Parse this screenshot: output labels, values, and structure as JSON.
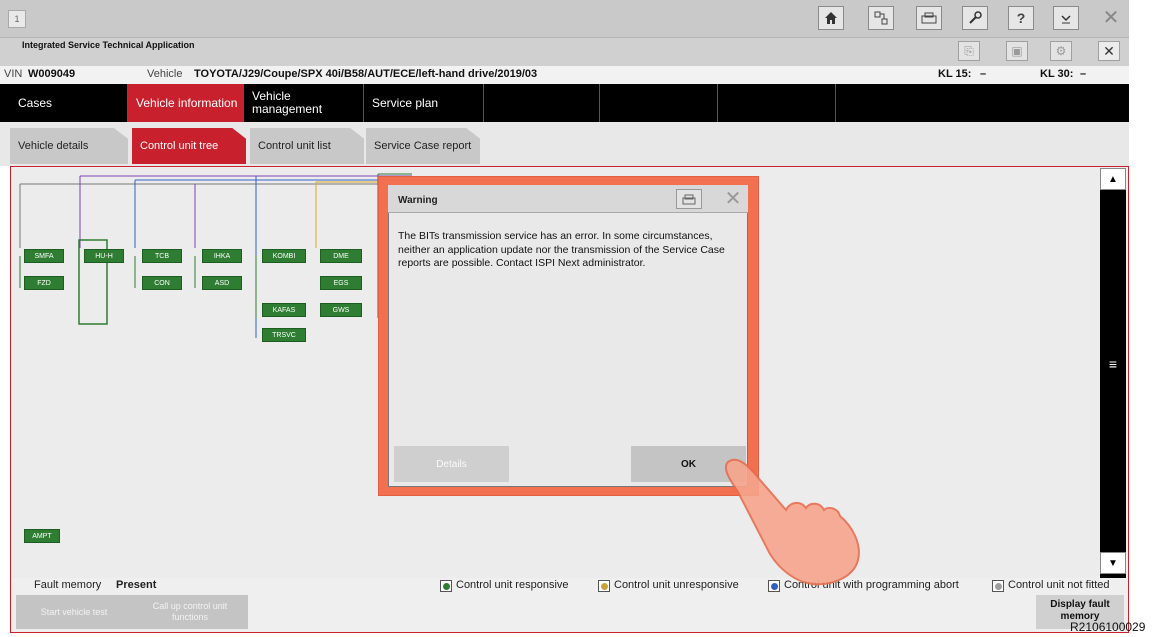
{
  "window": {
    "number": "1"
  },
  "app": {
    "title": "Integrated Service Technical Application"
  },
  "vehicle_bar": {
    "vin_label": "VIN",
    "vin_value": "W009049",
    "vehicle_label": "Vehicle",
    "vehicle_value": "TOYOTA/J29/Coupe/SPX 40i/B58/AUT/ECE/left-hand drive/2019/03",
    "kl15_label": "KL 15:",
    "kl15_value": "–",
    "kl30_label": "KL 30:",
    "kl30_value": "–"
  },
  "nav": {
    "tabs": [
      {
        "label": "Cases"
      },
      {
        "label": "Vehicle information"
      },
      {
        "label": "Vehicle management"
      },
      {
        "label": "Service plan"
      }
    ]
  },
  "subtabs": [
    {
      "label": "Vehicle details"
    },
    {
      "label": "Control unit tree"
    },
    {
      "label": "Control unit list"
    },
    {
      "label": "Service Case report"
    }
  ],
  "ecus": [
    "SMFA",
    "HU-H",
    "TCB",
    "IHKA",
    "KOMBI",
    "DME",
    "FZD",
    "CON",
    "ASD",
    "EGS",
    "KAFAS",
    "GWS",
    "TRSVC",
    "AMPT"
  ],
  "legend": {
    "fault_memory_label": "Fault memory",
    "fault_memory_value": "Present",
    "items": [
      {
        "label": "Control unit responsive",
        "color": "#2e7d32"
      },
      {
        "label": "Control unit unresponsive",
        "color": "#c9a23a"
      },
      {
        "label": "Control unit with programming abort",
        "color": "#2f5fc4"
      },
      {
        "label": "Control unit not fitted",
        "color": "#9e9e9e"
      }
    ]
  },
  "buttons": {
    "start_vehicle_test": "Start vehicle test",
    "call_up_functions": "Call up control unit functions",
    "display_fault_memory": "Display fault memory"
  },
  "dialog": {
    "title": "Warning",
    "message": "The BITs transmission service has an error. In some circumstances, neither an application update nor the transmission of the Service Case reports are possible. Contact ISPI Next administrator.",
    "details_label": "Details",
    "ok_label": "OK"
  },
  "reference": "R2106100029",
  "icons": [
    "home-icon",
    "connection-icon",
    "print-icon",
    "wrench-icon",
    "help-icon",
    "minimize-icon",
    "close-icon",
    "export-icon",
    "settings-icon",
    "mail-icon"
  ]
}
